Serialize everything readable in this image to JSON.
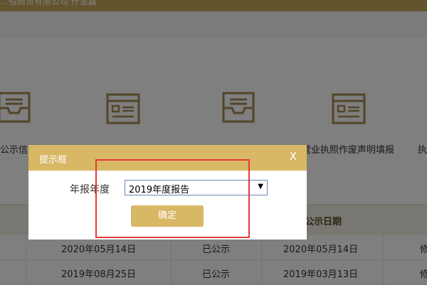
{
  "header": {
    "company_text": "…佰商贸有限公司    什金鑫"
  },
  "cards": [
    {
      "label": "公示信息",
      "icon": "inbox-tray-icon"
    },
    {
      "label": "",
      "icon": "form-document-icon"
    },
    {
      "label": "",
      "icon": "inbox-tray-icon"
    },
    {
      "label": "营业执照作废声明填报",
      "icon": "form-document-icon"
    },
    {
      "label": "执",
      "icon": ""
    }
  ],
  "table": {
    "last_header": "公示日期",
    "rows": [
      {
        "date1": "2020年05月14日",
        "status": "已公示",
        "date2": "2020年05月14日",
        "action": "修"
      },
      {
        "date1": "2019年08月25日",
        "status": "已公示",
        "date2": "2019年03月13日",
        "action": "修"
      }
    ]
  },
  "dialog": {
    "title": "提示框",
    "close_label": "X",
    "field_label": "年报年度",
    "select_value": "2019年度报告",
    "select_arrow": "▼",
    "confirm_label": "确定"
  },
  "colors": {
    "accent": "#d8b765",
    "header": "#c9a85c",
    "highlight": "#e53935",
    "select_border": "#6d8ab8"
  }
}
